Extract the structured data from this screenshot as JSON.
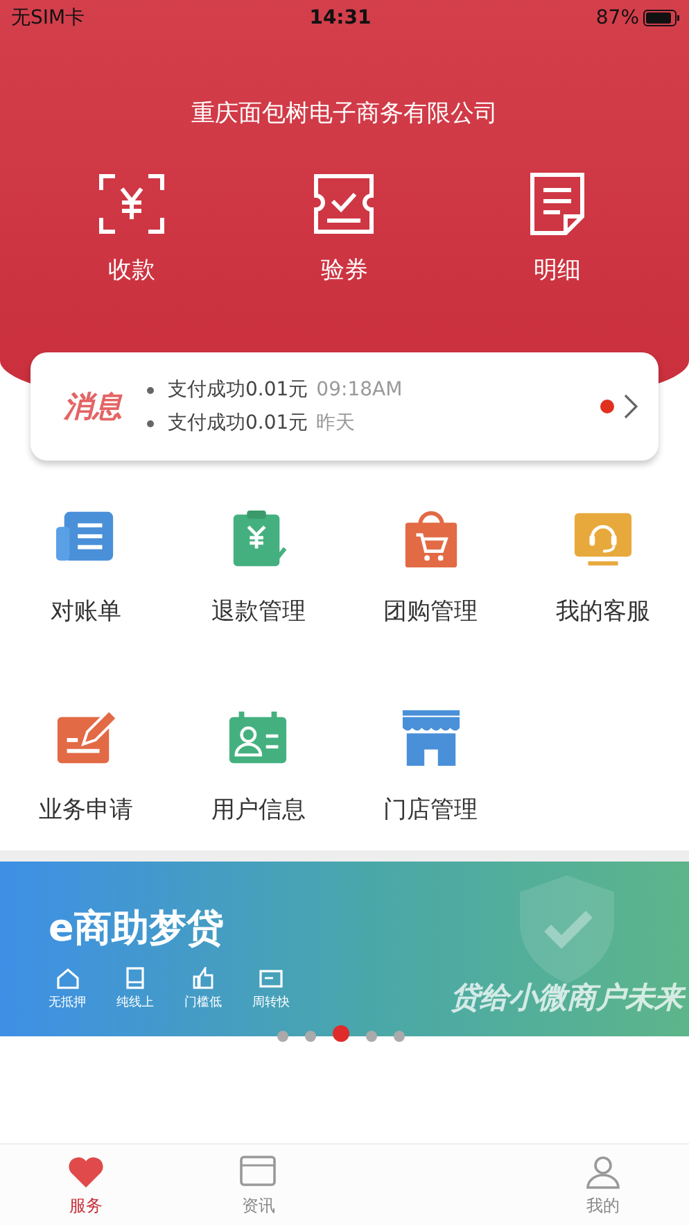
{
  "status_bar": {
    "carrier": "无SIM卡",
    "time": "14:31",
    "battery": "87%"
  },
  "header": {
    "title": "重庆面包树电子商务有限公司",
    "actions": [
      {
        "kind": "collect",
        "label": "收款"
      },
      {
        "kind": "voucher",
        "label": "验券"
      },
      {
        "kind": "detail",
        "label": "明细"
      }
    ]
  },
  "messages": {
    "badge": "消息",
    "unread": true,
    "items": [
      {
        "text": "支付成功0.01元",
        "time": "09:18AM"
      },
      {
        "text": "支付成功0.01元",
        "time": "昨天"
      }
    ]
  },
  "menu": [
    {
      "kind": "statement",
      "label": "对账单"
    },
    {
      "kind": "refund",
      "label": "退款管理"
    },
    {
      "kind": "group",
      "label": "团购管理"
    },
    {
      "kind": "service",
      "label": "我的客服"
    },
    {
      "kind": "apply",
      "label": "业务申请"
    },
    {
      "kind": "user",
      "label": "用户信息"
    },
    {
      "kind": "store",
      "label": "门店管理"
    }
  ],
  "banner": {
    "title": "e商助梦贷",
    "features": [
      "无抵押",
      "纯线上",
      "门槛低",
      "周转快"
    ],
    "slogan": "贷给小微商户未来",
    "dots": [
      {
        "selected": false
      },
      {
        "selected": false
      },
      {
        "selected": true
      },
      {
        "selected": false
      },
      {
        "selected": false
      }
    ]
  },
  "tabs": [
    {
      "kind": "service",
      "label": "服务",
      "selected": true
    },
    {
      "kind": "news",
      "label": "资讯",
      "selected": false
    },
    {
      "kind": "me",
      "label": "我的",
      "selected": false
    }
  ]
}
